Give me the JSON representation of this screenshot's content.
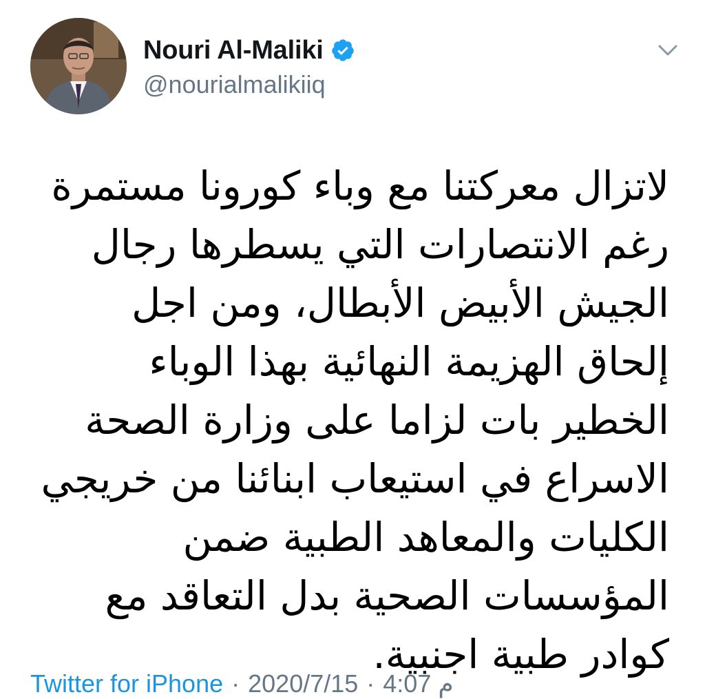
{
  "tweet": {
    "author": {
      "display_name": "Nouri Al-Maliki",
      "handle": "@nourialmalikiiq",
      "verified": true,
      "avatar_icon": "profile-photo"
    },
    "menu_icon": "chevron-down-icon",
    "text": "لاتزال معركتنا مع وباء كورونا مستمرة رغم الانتصارات التي يسطرها رجال الجيش الأبيض الأبطال، ومن اجل إلحاق الهزيمة النهائية بهذا الوباء الخطير بات لزاما على وزارة الصحة الاسراع في استيعاب ابنائنا من خريجي الكليات والمعاهد الطبية ضمن المؤسسات الصحية بدل التعاقد مع كوادر طبية اجنبية.",
    "footer": {
      "source": "Twitter for iPhone",
      "separator": "·",
      "date": "2020/7/15",
      "time": "م 4:07"
    },
    "colors": {
      "link": "#1b95e0",
      "verified_badge": "#1da1f2",
      "secondary_text": "#657786"
    }
  }
}
